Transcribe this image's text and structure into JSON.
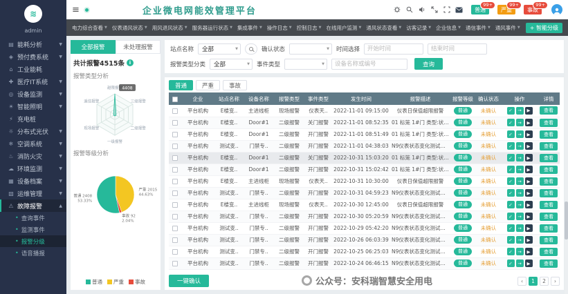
{
  "app": {
    "title": "企业微电网能效管理平台"
  },
  "sidebar": {
    "user": "admin",
    "logo_glyph": "≋",
    "items": [
      {
        "label": "能耗分析",
        "icon": "energy-analysis-icon",
        "glyph": "▤",
        "arrow": true
      },
      {
        "label": "预付费系统",
        "icon": "prepaid-system-icon",
        "glyph": "◈",
        "arrow": true
      },
      {
        "label": "工业能耗",
        "icon": "industry-energy-icon",
        "glyph": "⌂",
        "arrow": false
      },
      {
        "label": "医疗IT系统",
        "icon": "medical-it-icon",
        "glyph": "✚",
        "arrow": true
      },
      {
        "label": "设备监测",
        "icon": "device-monitor-icon",
        "glyph": "◎",
        "arrow": true
      },
      {
        "label": "智能照明",
        "icon": "smart-lighting-icon",
        "glyph": "☀",
        "arrow": true
      },
      {
        "label": "充电桩",
        "icon": "charging-pile-icon",
        "glyph": "⚡",
        "arrow": false
      },
      {
        "label": "分布式光伏",
        "icon": "solar-pv-icon",
        "glyph": "☼",
        "arrow": true
      },
      {
        "label": "空调系统",
        "icon": "hvac-icon",
        "glyph": "❄",
        "arrow": true
      },
      {
        "label": "消防火灾",
        "icon": "fire-safety-icon",
        "glyph": "♨",
        "arrow": true
      },
      {
        "label": "环境监测",
        "icon": "environment-icon",
        "glyph": "☁",
        "arrow": true
      },
      {
        "label": "设备档案",
        "icon": "device-archive-icon",
        "glyph": "▦",
        "arrow": true
      },
      {
        "label": "运维管理",
        "icon": "maintenance-icon",
        "glyph": "▧",
        "arrow": true
      },
      {
        "label": "故障报警",
        "icon": "fault-alarm-icon",
        "glyph": "⚠",
        "arrow": true,
        "active": true,
        "expanded": true,
        "children": [
          {
            "label": "查询事件"
          },
          {
            "label": "监测事件"
          },
          {
            "label": "报警分级",
            "active": true
          },
          {
            "label": "语音播报"
          }
        ]
      }
    ]
  },
  "topbar": {
    "hamburger": "≡",
    "icons": [
      "gear-icon",
      "search-icon",
      "volume-icon",
      "expand-icon",
      "fullscreen-icon",
      "mail-icon"
    ],
    "alarm_buttons": [
      {
        "label": "普通",
        "count": "99+",
        "color": "#26b99a"
      },
      {
        "label": "严重",
        "count": "99+",
        "color": "#f39c12"
      },
      {
        "label": "事故",
        "count": "99+",
        "color": "#e74c3c"
      }
    ]
  },
  "navbar": {
    "items": [
      "电力综合查看",
      "仪表通风状态",
      "用风退风状态",
      "服务器运行状态",
      "集成事件",
      "操作日志",
      "控制日志",
      "在线用户监测",
      "通风状态查看",
      "访客记录",
      "企业信息",
      "通信事件",
      "通风事件"
    ],
    "action": "+ 智能分级"
  },
  "left_panel": {
    "tabs": [
      {
        "label": "全部报警",
        "active": true
      },
      {
        "label": "未处理报警",
        "active": false
      }
    ],
    "total_text": "共计报警4515条",
    "type_title": "报警类型分析",
    "level_title": "报警等级分析"
  },
  "chart_data": [
    {
      "type": "radar",
      "title": "报警类型分析",
      "categories": [
        "越限报警",
        "三级报警",
        "二级报警",
        "一级报警",
        "现场报警",
        "遥信报警"
      ],
      "values": [
        4408,
        60,
        220,
        90,
        160,
        120
      ],
      "max_label": "4408"
    },
    {
      "type": "pie",
      "title": "报警等级分析",
      "slices": [
        {
          "label": "严重",
          "value": 2015,
          "percent": "44.63%",
          "color": "#f3c622"
        },
        {
          "label": "事故",
          "value": 92,
          "percent": "2.04%",
          "color": "#e74c3c"
        },
        {
          "label": "普通",
          "value": 2408,
          "percent": "53.33%",
          "color": "#26b99a"
        }
      ],
      "total": 4515,
      "legend": [
        {
          "label": "普通",
          "color": "#26b99a"
        },
        {
          "label": "严重",
          "color": "#f3c622"
        },
        {
          "label": "事故",
          "color": "#e74c3c"
        }
      ]
    }
  ],
  "filters": {
    "site_label": "站点名称",
    "site_value": "全部",
    "confirm_label": "确认状态",
    "confirm_value": "",
    "time_label": "时间选择",
    "start_placeholder": "开始时间",
    "end_placeholder": "结束时间",
    "type_label": "报警类型分类",
    "type_value": "全部",
    "event_label": "事件类型",
    "event_value": "",
    "device_placeholder": "设备名称或编号",
    "query_label": "查询"
  },
  "severity_tabs": [
    {
      "label": "普通",
      "active": true
    },
    {
      "label": "严重",
      "active": false
    },
    {
      "label": "事故",
      "active": false
    }
  ],
  "table": {
    "headers": [
      "企业",
      "站点名称",
      "设备名称",
      "报警类型",
      "事件类型",
      "发生时间",
      "报警描述",
      "报警等级",
      "确认状态",
      "操作",
      "详情"
    ],
    "op_icons": [
      {
        "name": "confirm-icon",
        "glyph": "✓",
        "color": "#26b99a"
      },
      {
        "name": "forward-icon",
        "glyph": "→",
        "color": "#26b99a"
      },
      {
        "name": "video-icon",
        "glyph": "▶",
        "color": "#2c3e50"
      }
    ],
    "rows": [
      {
        "company": "平台机构",
        "site": "E楼变..",
        "device": "主进线柜",
        "alarm_type": "现场报警",
        "event_type": "仪表天..",
        "time": "2022-11-01 09:15:00",
        "desc": "仪表日保值超限报警",
        "level": "普通",
        "status": "未确认",
        "detail": "查看"
      },
      {
        "company": "平台机构",
        "site": "E楼变..",
        "device": "Door#1",
        "alarm_type": "二级报警",
        "event_type": "关门报警",
        "time": "2022-11-01 08:52:35",
        "desc": "01 标笼 1#门 类型:状态变化 当前..",
        "level": "普通",
        "status": "未确认",
        "detail": "查看"
      },
      {
        "company": "平台机构",
        "site": "E楼变..",
        "device": "Door#1",
        "alarm_type": "二级报警",
        "event_type": "开门报警",
        "time": "2022-11-01 08:51:49",
        "desc": "01 标笼 1#门 类型:状态变化 当前..",
        "level": "普通",
        "status": "未确认",
        "detail": "查看"
      },
      {
        "company": "平台机构",
        "site": "测试变..",
        "device": "门禁专..",
        "alarm_type": "二级报警",
        "event_type": "开门报警",
        "time": "2022-11-01 04:38:03",
        "desc": "N9仪表状态变化测试，需要停改变..",
        "level": "普通",
        "status": "未确认",
        "detail": "查看"
      },
      {
        "company": "平台机构",
        "site": "E楼变..",
        "device": "Door#1",
        "alarm_type": "二级报警",
        "event_type": "关门报警",
        "time": "2022-10-31 15:03:20",
        "desc": "01 标笼 1#门 类型:状态变化 当前..",
        "level": "普通",
        "status": "未确认",
        "detail": "查看",
        "highlighted": true
      },
      {
        "company": "平台机构",
        "site": "E楼变..",
        "device": "Door#1",
        "alarm_type": "二级报警",
        "event_type": "开门报警",
        "time": "2022-10-31 15:02:42",
        "desc": "01 标笼 1#门 类型:状态变化 当前..",
        "level": "普通",
        "status": "未确认",
        "detail": "查看"
      },
      {
        "company": "平台机构",
        "site": "E楼变..",
        "device": "主进线柜",
        "alarm_type": "现场报警",
        "event_type": "仪表天..",
        "time": "2022-10-31 10:30:00",
        "desc": "仪表日保值超限报警",
        "level": "普通",
        "status": "未确认",
        "detail": "查看"
      },
      {
        "company": "平台机构",
        "site": "测试变..",
        "device": "门禁专..",
        "alarm_type": "二级报警",
        "event_type": "开门报警",
        "time": "2022-10-31 04:59:23",
        "desc": "N9仪表状态变化测试，需要停改变..",
        "level": "普通",
        "status": "未确认",
        "detail": "查看"
      },
      {
        "company": "平台机构",
        "site": "E楼变..",
        "device": "主进线柜",
        "alarm_type": "现场报警",
        "event_type": "仪表天..",
        "time": "2022-10-30 12:45:00",
        "desc": "仪表日保值超限报警",
        "level": "普通",
        "status": "未确认",
        "detail": "查看"
      },
      {
        "company": "平台机构",
        "site": "测试变..",
        "device": "门禁专..",
        "alarm_type": "二级报警",
        "event_type": "开门报警",
        "time": "2022-10-30 05:20:59",
        "desc": "N9仪表状态变化测试，需要停改变..",
        "level": "普通",
        "status": "未确认",
        "detail": "查看"
      },
      {
        "company": "平台机构",
        "site": "测试变..",
        "device": "门禁专..",
        "alarm_type": "二级报警",
        "event_type": "开门报警",
        "time": "2022-10-29 05:42:20",
        "desc": "N9仪表状态变化测试，需要停改变..",
        "level": "普通",
        "status": "未确认",
        "detail": "查看"
      },
      {
        "company": "平台机构",
        "site": "测试变..",
        "device": "门禁专..",
        "alarm_type": "二级报警",
        "event_type": "开门报警",
        "time": "2022-10-26 06:03:39",
        "desc": "N9仪表状态变化测试，需要停改变..",
        "level": "普通",
        "status": "未确认",
        "detail": "查看"
      },
      {
        "company": "平台机构",
        "site": "测试变..",
        "device": "门禁专..",
        "alarm_type": "二级报警",
        "event_type": "开门报警",
        "time": "2022-10-25 06:25:03",
        "desc": "N9仪表状态变化测试，需要停改变..",
        "level": "普通",
        "status": "未确认",
        "detail": "查看"
      },
      {
        "company": "平台机构",
        "site": "测试变..",
        "device": "门禁专..",
        "alarm_type": "二级报警",
        "event_type": "开门报警",
        "time": "2022-10-24 06:46:15",
        "desc": "N9仪表状态变化测试，需要停改变..",
        "level": "普通",
        "status": "未确认",
        "detail": "查看"
      }
    ]
  },
  "footer": {
    "confirm_all": "一键确认"
  },
  "pagination": {
    "pages": [
      "1",
      "2"
    ],
    "active": "1"
  },
  "watermark": {
    "text": "公众号：安科瑞智慧安全用电"
  }
}
